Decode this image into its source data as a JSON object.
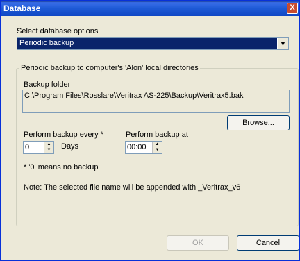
{
  "window": {
    "title": "Database",
    "close_glyph": "X"
  },
  "options": {
    "label": "Select database options",
    "selected": "Periodic backup"
  },
  "group": {
    "title": "Periodic backup to computer's 'Alon' local directories",
    "folder_label": "Backup folder",
    "folder_value": "C:\\Program Files\\Rosslare\\Veritrax AS-225\\Backup\\Veritrax5.bak",
    "browse_label": "Browse...",
    "every_label": "Perform backup every *",
    "every_value": "0",
    "days_label": "Days",
    "at_label": "Perform backup at",
    "at_value": "00:00",
    "footnote": "* '0' means no backup",
    "note": "Note: The selected file name will be appended with  _Veritrax_v6"
  },
  "buttons": {
    "ok": "OK",
    "cancel": "Cancel"
  }
}
